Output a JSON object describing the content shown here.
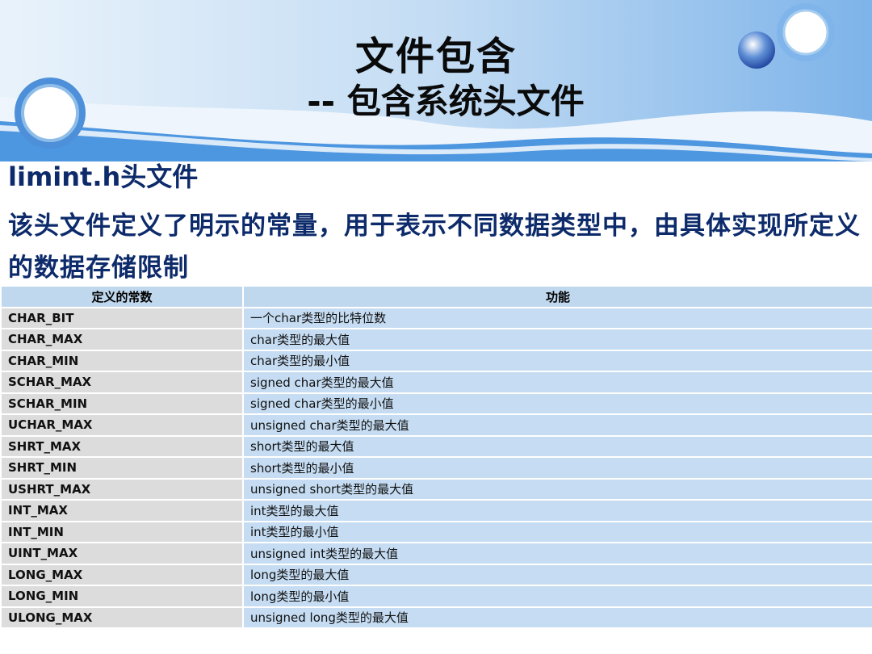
{
  "slide": {
    "title": "文件包含",
    "subtitle": "-- 包含系统头文件",
    "heading": "limint.h头文件",
    "description": "该头文件定义了明示的常量，用于表示不同数据类型中，由具体实现所定义的数据存储限制"
  },
  "table": {
    "headers": [
      "定义的常数",
      "功能"
    ],
    "rows": [
      {
        "constant": "CHAR_BIT",
        "function": "一个char类型的比特位数"
      },
      {
        "constant": "CHAR_MAX",
        "function": "char类型的最大值"
      },
      {
        "constant": "CHAR_MIN",
        "function": "char类型的最小值"
      },
      {
        "constant": "SCHAR_MAX",
        "function": "signed char类型的最大值"
      },
      {
        "constant": "SCHAR_MIN",
        "function": "signed char类型的最小值"
      },
      {
        "constant": "UCHAR_MAX",
        "function": "unsigned char类型的最大值"
      },
      {
        "constant": "SHRT_MAX",
        "function": "short类型的最大值"
      },
      {
        "constant": "SHRT_MIN",
        "function": "short类型的最小值"
      },
      {
        "constant": "USHRT_MAX",
        "function": "unsigned short类型的最大值"
      },
      {
        "constant": "INT_MAX",
        "function": "int类型的最大值"
      },
      {
        "constant": "INT_MIN",
        "function": "int类型的最小值"
      },
      {
        "constant": "UINT_MAX",
        "function": "unsigned int类型的最大值"
      },
      {
        "constant": "LONG_MAX",
        "function": "long类型的最大值"
      },
      {
        "constant": "LONG_MIN",
        "function": "long类型的最小值"
      },
      {
        "constant": "ULONG_MAX",
        "function": "unsigned long类型的最大值"
      }
    ]
  },
  "colors": {
    "header_blue": "#5a9fe0",
    "text_navy": "#0d2b6b",
    "const_cell": "#dcdcdc",
    "func_cell": "#c5dcf2"
  }
}
